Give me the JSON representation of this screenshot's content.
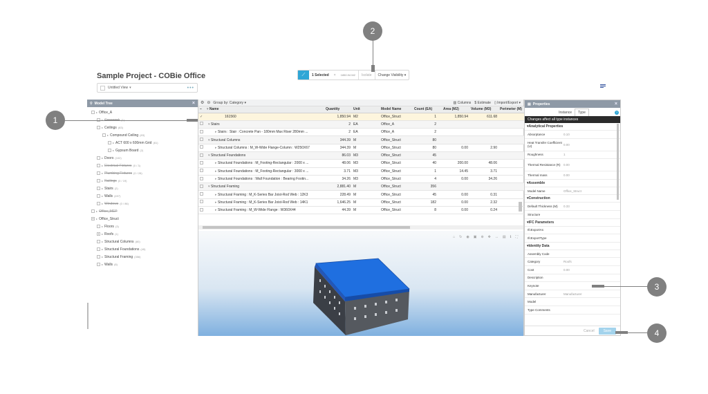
{
  "header": {
    "project_title": "Sample Project - COBie Office",
    "view_name": "Untitled View",
    "view_dots": "•••"
  },
  "selection_bar": {
    "count_label": "1 Selected",
    "close": "×",
    "quantity": "1850.94 M2",
    "isolate_label": "Isolate",
    "visibility_label": "Change Visibility ▾"
  },
  "model_tree": {
    "title": "Model Tree",
    "items": [
      {
        "label": "Office_A",
        "indent": 0,
        "num": ""
      },
      {
        "label": "Casework",
        "indent": 1,
        "num": "(1)",
        "strike": true
      },
      {
        "label": "Ceilings",
        "indent": 1,
        "num": "(83)"
      },
      {
        "label": "Compound Ceiling",
        "indent": 2,
        "num": "(83)"
      },
      {
        "label": "ACT 600 x 600mm Grid",
        "indent": 3,
        "num": "(81)"
      },
      {
        "label": "Gypsum Board",
        "indent": 3,
        "num": "(2)"
      },
      {
        "label": "Doors",
        "indent": 1,
        "num": "(102)"
      },
      {
        "label": "Electrical Fixtures",
        "indent": 1,
        "num": "(0 / 3)",
        "strike": true
      },
      {
        "label": "Plumbing Fixtures",
        "indent": 1,
        "num": "(0 / 28)",
        "strike": true
      },
      {
        "label": "Railings",
        "indent": 1,
        "num": "(0 / 19)",
        "strike": true
      },
      {
        "label": "Stairs",
        "indent": 1,
        "num": "(2)"
      },
      {
        "label": "Walls",
        "indent": 1,
        "num": "(497)"
      },
      {
        "label": "Windows",
        "indent": 1,
        "num": "(0 / 86)",
        "strike": true
      },
      {
        "label": "Office_MEP",
        "indent": 0,
        "num": "",
        "strike": true
      },
      {
        "label": "Office_Struct",
        "indent": 0,
        "num": "",
        "partial": true
      },
      {
        "label": "Floors",
        "indent": 1,
        "num": "(3)"
      },
      {
        "label": "Roofs",
        "indent": 1,
        "num": "(1)",
        "partial": true
      },
      {
        "label": "Structural Columns",
        "indent": 1,
        "num": "(80)"
      },
      {
        "label": "Structural Foundations",
        "indent": 1,
        "num": "(45)"
      },
      {
        "label": "Structural Framing",
        "indent": 1,
        "num": "(356)"
      },
      {
        "label": "Walls",
        "indent": 1,
        "num": "(8)"
      }
    ]
  },
  "grid_toolbar": {
    "group_by": "Group by: Category ▾",
    "columns": "Columns",
    "estimate": "$ Estimate",
    "import_export": "Import/Export ▾"
  },
  "grid": {
    "columns": [
      "Name",
      "Quantity",
      "Unit",
      "Model Name",
      "Count (EA)",
      "Area (M2)",
      "Volume (M3)",
      "Perimeter (M)"
    ],
    "rows": [
      {
        "type": "sel",
        "name": "161560",
        "qty": "1,850.94",
        "unit": "M2",
        "model": "Office_Struct",
        "count": "1",
        "area": "1,850.94",
        "vol": "611.68",
        "per": ""
      },
      {
        "type": "grp",
        "name": "Stairs",
        "qty": "2",
        "unit": "EA",
        "model": "Office_A",
        "count": "2",
        "area": "",
        "vol": "",
        "per": ""
      },
      {
        "type": "row",
        "name": "Stairs : Stair : Concrete Pan - 180mm Max Riser 280mm ...",
        "qty": "2",
        "unit": "EA",
        "model": "Office_A",
        "count": "2",
        "area": "",
        "vol": "",
        "per": ""
      },
      {
        "type": "grp",
        "name": "Structural Columns",
        "qty": "344.39",
        "unit": "M",
        "model": "Office_Struct",
        "count": "80",
        "area": "",
        "vol": "",
        "per": ""
      },
      {
        "type": "row",
        "name": "Structural Columns : M_W-Wide Flange-Column : W250X67",
        "qty": "344.39",
        "unit": "M",
        "model": "Office_Struct",
        "count": "80",
        "area": "0.00",
        "vol": "2.90",
        "per": ""
      },
      {
        "type": "grp",
        "name": "Structural Foundations",
        "qty": "86.03",
        "unit": "M3",
        "model": "Office_Struct",
        "count": "45",
        "area": "",
        "vol": "",
        "per": ""
      },
      {
        "type": "row",
        "name": "Structural Foundations : M_Footing-Rectangular : 2000 x ...",
        "qty": "48.06",
        "unit": "M3",
        "model": "Office_Struct",
        "count": "40",
        "area": "200.00",
        "vol": "48.06",
        "per": ""
      },
      {
        "type": "row",
        "name": "Structural Foundations : M_Footing-Rectangular : 3000 x ...",
        "qty": "3.71",
        "unit": "M3",
        "model": "Office_Struct",
        "count": "1",
        "area": "14.45",
        "vol": "3.71",
        "per": ""
      },
      {
        "type": "row",
        "name": "Structural Foundations : Wall Foundation : Bearing Footin...",
        "qty": "34.26",
        "unit": "M3",
        "model": "Office_Struct",
        "count": "4",
        "area": "0.00",
        "vol": "34.26",
        "per": ""
      },
      {
        "type": "grp",
        "name": "Structural Framing",
        "qty": "2,881.40",
        "unit": "M",
        "model": "Office_Struct",
        "count": "356",
        "area": "",
        "vol": "",
        "per": ""
      },
      {
        "type": "row",
        "name": "Structural Framing : M_K-Series Bar Joist-Rod Web : 12K3",
        "qty": "228.49",
        "unit": "M",
        "model": "Office_Struct",
        "count": "45",
        "area": "0.00",
        "vol": "0.31",
        "per": ""
      },
      {
        "type": "row",
        "name": "Structural Framing : M_K-Series Bar Joist-Rod Web : 14K1",
        "qty": "1,646.25",
        "unit": "M",
        "model": "Office_Struct",
        "count": "182",
        "area": "0.00",
        "vol": "2.32",
        "per": ""
      },
      {
        "type": "row",
        "name": "Structural Framing : M_W-Wide Flange : W360X44",
        "qty": "44.39",
        "unit": "M",
        "model": "Office_Struct",
        "count": "8",
        "area": "0.00",
        "vol": "0.24",
        "per": ""
      }
    ]
  },
  "properties": {
    "title": "Properties",
    "tab_instance": "Instance",
    "tab_type": "Type",
    "help": "?",
    "notice": "Changes affect all type instances",
    "sections": [
      {
        "title": "Analytical Properties",
        "rows": [
          {
            "k": "Absorptance",
            "v": "0.10"
          },
          {
            "k": "Heat Transfer Coefficient (U)",
            "v": "0.00",
            "tall": true
          },
          {
            "k": "Roughness",
            "v": "1"
          },
          {
            "k": "Thermal Resistance (R)",
            "v": "0.00",
            "tall": true
          },
          {
            "k": "Thermal mass",
            "v": "0.00"
          }
        ]
      },
      {
        "title": "Assemble",
        "rows": [
          {
            "k": "Model Name",
            "v": "Office_Struct"
          }
        ]
      },
      {
        "title": "Construction",
        "rows": [
          {
            "k": "Default Thickness (M)",
            "v": "0.33"
          },
          {
            "k": "Structure",
            "v": ""
          }
        ]
      },
      {
        "title": "IFC Parameters",
        "rows": [
          {
            "k": "IfcExportAs",
            "v": ""
          },
          {
            "k": "IfcExportType",
            "v": ""
          }
        ]
      },
      {
        "title": "Identity Data",
        "rows": [
          {
            "k": "Assembly Code",
            "v": ""
          },
          {
            "k": "Category",
            "v": "Roofs"
          },
          {
            "k": "Cost",
            "v": "0.00"
          },
          {
            "k": "Description",
            "v": ""
          },
          {
            "k": "Keynote",
            "v": ""
          },
          {
            "k": "Manufacturer",
            "v": "Manufacturer"
          },
          {
            "k": "Model",
            "v": ""
          },
          {
            "k": "Type Comments",
            "v": ""
          }
        ]
      }
    ],
    "cancel_label": "Cancel",
    "save_label": "Save"
  },
  "callouts": {
    "c1": "1",
    "c2": "2",
    "c3": "3",
    "c4": "4"
  },
  "colors": {
    "accent": "#2fa6d6",
    "panel_header": "#8e99a6",
    "callout": "#808080",
    "roof": "#1f6fe0"
  }
}
